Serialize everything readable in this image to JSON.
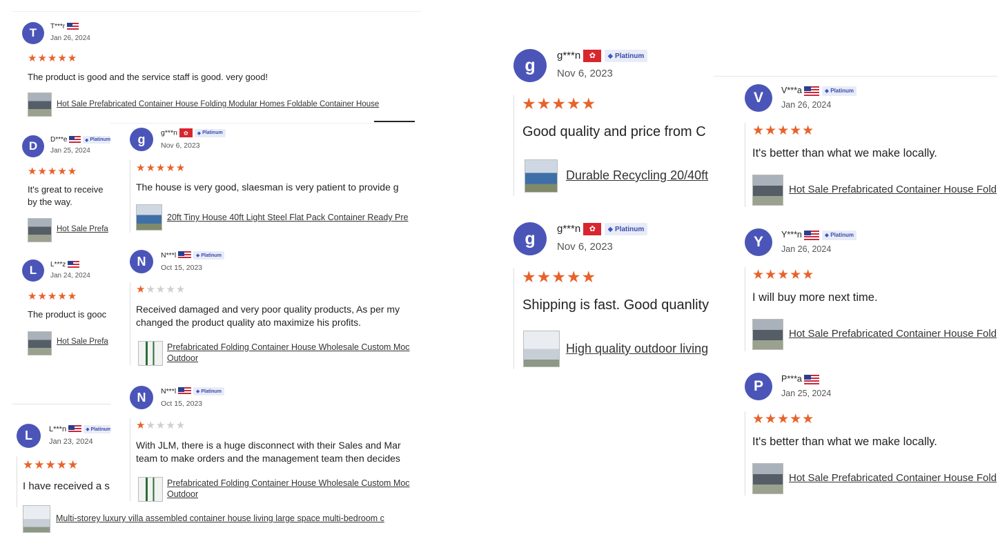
{
  "shared": {
    "platinum": "Platinum"
  },
  "left_col": [
    {
      "initial": "T",
      "name": "T***r",
      "flag": "us",
      "date": "Jan 26, 2024",
      "rating": 5,
      "text": "The product is good and the service staff is good. very good!",
      "link": "Hot Sale Prefabricated Container House Folding Modular Homes Foldable Container House"
    },
    {
      "initial": "D",
      "name": "D***e",
      "flag": "us",
      "platinum": true,
      "date": "Jan 25, 2024",
      "rating": 5,
      "text1": "It's great to receive",
      "text2": "by the way.",
      "link": "Hot Sale Prefa"
    },
    {
      "initial": "L",
      "name": "L***z",
      "flag": "us",
      "date": "Jan 24, 2024",
      "rating": 5,
      "text": "The product is gooc",
      "link": "Hot Sale Prefa"
    },
    {
      "initial": "L",
      "name": "L***n",
      "flag": "us",
      "platinum": true,
      "date": "Jan 23, 2024",
      "rating": 5,
      "text": "I have received a s",
      "link": "Multi-storey luxury villa assembled container house living large space multi-bedroom c"
    }
  ],
  "mid_col": [
    {
      "initial": "g",
      "name": "g***n",
      "flag": "hk",
      "platinum": true,
      "date": "Nov 6, 2023",
      "rating": 5,
      "text": "The house is very good, slaesman is very patient to provide g",
      "link": "20ft Tiny House 40ft Light Steel Flat Pack Container Ready Pre"
    },
    {
      "initial": "N",
      "name": "N***l",
      "flag": "us",
      "platinum": true,
      "date": "Oct 15, 2023",
      "rating": 1,
      "text1": "Received damaged and very poor quality products, As per my",
      "text2": "changed the product quality ato maximize his profits.",
      "link1": "Prefabricated Folding Container House Wholesale Custom Moc",
      "link2": "Outdoor"
    },
    {
      "initial": "N",
      "name": "N***l",
      "flag": "us",
      "platinum": true,
      "date": "Oct 15, 2023",
      "rating": 1,
      "text1": "With JLM, there is a huge disconnect with their Sales and Mar",
      "text2": "team to make orders and the management team then decides",
      "link1": "Prefabricated Folding Container House Wholesale Custom Moc",
      "link2": "Outdoor"
    }
  ],
  "right_a": [
    {
      "initial": "g",
      "name": "g***n",
      "flag": "hk",
      "platinum": true,
      "date": "Nov 6, 2023",
      "rating": 5,
      "text": "Good quality and price from C",
      "link": "Durable Recycling 20/40ft"
    },
    {
      "initial": "g",
      "name": "g***n",
      "flag": "hk",
      "platinum": true,
      "date": "Nov 6, 2023",
      "rating": 5,
      "text": "Shipping is fast. Good quanlity",
      "link": "High quality outdoor living"
    }
  ],
  "right_b": [
    {
      "initial": "V",
      "name": "V***a",
      "flag": "us",
      "platinum": true,
      "date": "Jan 26, 2024",
      "rating": 5,
      "text": "It's better than what we make locally.",
      "link": "Hot Sale Prefabricated Container House Fold"
    },
    {
      "initial": "Y",
      "name": "Y***n",
      "flag": "us",
      "platinum": true,
      "date": "Jan 26, 2024",
      "rating": 5,
      "text": "I will buy more next time.",
      "link": "Hot Sale Prefabricated Container House Fold"
    },
    {
      "initial": "P",
      "name": "P***a",
      "flag": "us",
      "date": "Jan 25, 2024",
      "rating": 5,
      "text": "It's better than what we make locally.",
      "link": "Hot Sale Prefabricated Container House Fold"
    }
  ],
  "colors": {
    "avatar": "#4b55b8",
    "star": "#e8622a",
    "star_off": "#cfcfcf"
  }
}
